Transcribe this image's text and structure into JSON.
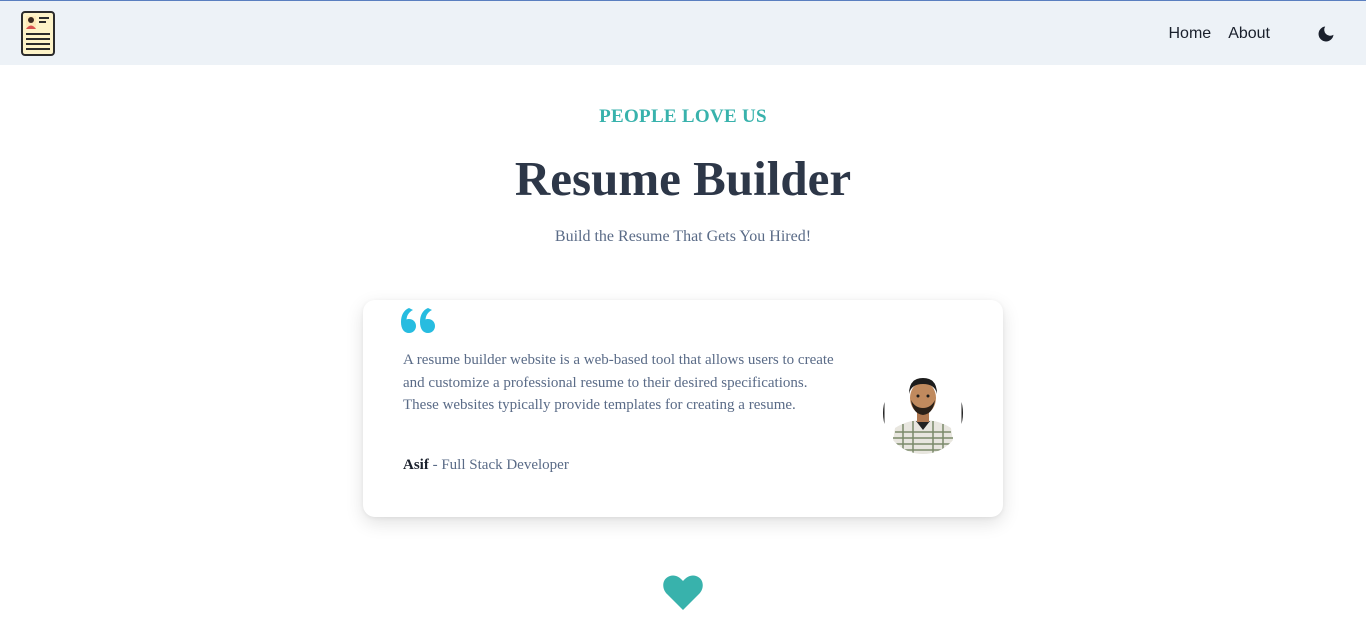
{
  "navbar": {
    "links": [
      "Home",
      "About"
    ]
  },
  "hero": {
    "eyebrow": "PEOPLE LOVE US",
    "title": "Resume Builder",
    "subtitle": "Build the Resume That Gets You Hired!"
  },
  "testimonial": {
    "quote": "A resume builder website is a web-based tool that allows users to create and customize a professional resume to their desired specifications. These websites typically provide templates for creating a resume.",
    "author_name": "Asif",
    "author_separator": " - ",
    "author_role": "Full Stack Developer"
  },
  "icons": {
    "logo": "resume-document-icon",
    "theme_toggle": "moon-icon",
    "quote": "quote-icon",
    "heart": "heart-icon"
  },
  "colors": {
    "accent": "#38b2ac",
    "quote_icon": "#27bce0",
    "navbar_bg": "#edf2f7",
    "heading": "#2d3748",
    "body_text": "#5a6b87"
  }
}
